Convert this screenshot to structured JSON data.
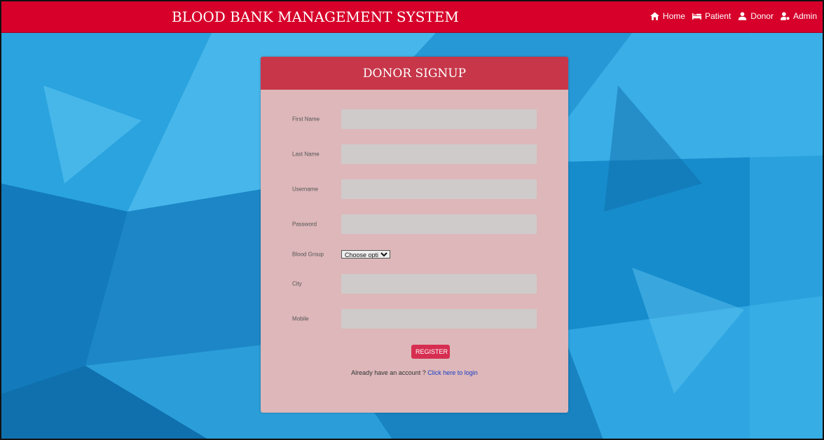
{
  "app_title": "BLOOD BANK MANAGEMENT SYSTEM",
  "nav": {
    "items": [
      {
        "label": "Home",
        "icon": "home-icon"
      },
      {
        "label": "Patient",
        "icon": "bed-icon"
      },
      {
        "label": "Donor",
        "icon": "user-icon"
      },
      {
        "label": "Admin",
        "icon": "user-cog-icon"
      }
    ]
  },
  "card": {
    "title": "DONOR SIGNUP",
    "fields": [
      {
        "label": "First Name",
        "value": ""
      },
      {
        "label": "Last Name",
        "value": ""
      },
      {
        "label": "Username",
        "value": ""
      },
      {
        "label": "Password",
        "value": ""
      },
      {
        "label": "Blood Group",
        "select_value": "Choose option"
      },
      {
        "label": "City",
        "value": ""
      },
      {
        "label": "Mobile",
        "value": ""
      }
    ],
    "register_label": "REGISTER",
    "login_prompt": "Already have an account ?",
    "login_link": "Click here to login"
  },
  "colors": {
    "navbar": "#d6002a",
    "card_header": "#c73649",
    "card_body": "#ddb7b9",
    "register_button": "#d62e50"
  }
}
